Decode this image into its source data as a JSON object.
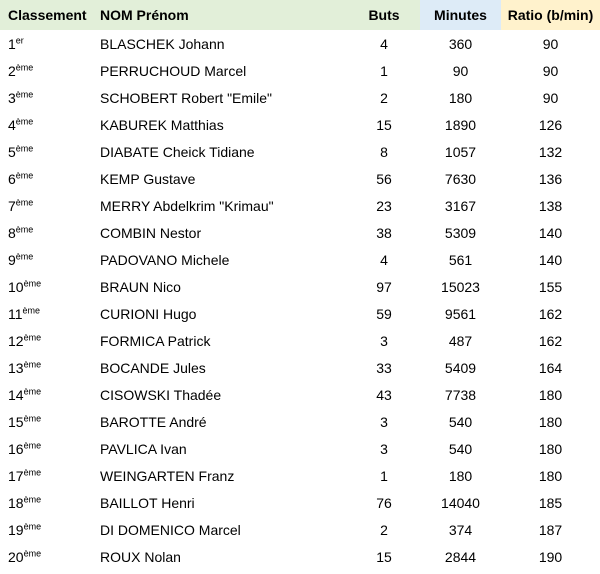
{
  "headers": {
    "rank": "Classement",
    "name": "NOM Prénom",
    "goals": "Buts",
    "minutes": "Minutes",
    "ratio": "Ratio (b/min)"
  },
  "colors": {
    "header_green": "#e2efd9",
    "header_blue": "#ddebf7",
    "header_yellow": "#fff2cc"
  },
  "rows": [
    {
      "rank": "1",
      "suffix": "er",
      "name": "BLASCHEK Johann",
      "goals": "4",
      "minutes": "360",
      "ratio": "90"
    },
    {
      "rank": "2",
      "suffix": "ème",
      "name": "PERRUCHOUD Marcel",
      "goals": "1",
      "minutes": "90",
      "ratio": "90"
    },
    {
      "rank": "3",
      "suffix": "ème",
      "name": "SCHOBERT Robert \"Emile\"",
      "goals": "2",
      "minutes": "180",
      "ratio": "90"
    },
    {
      "rank": "4",
      "suffix": "ème",
      "name": "KABUREK Matthias",
      "goals": "15",
      "minutes": "1890",
      "ratio": "126"
    },
    {
      "rank": "5",
      "suffix": "ème",
      "name": "DIABATE Cheick Tidiane",
      "goals": "8",
      "minutes": "1057",
      "ratio": "132"
    },
    {
      "rank": "6",
      "suffix": "ème",
      "name": "KEMP Gustave",
      "goals": "56",
      "minutes": "7630",
      "ratio": "136"
    },
    {
      "rank": "7",
      "suffix": "ème",
      "name": "MERRY Abdelkrim \"Krimau\"",
      "goals": "23",
      "minutes": "3167",
      "ratio": "138"
    },
    {
      "rank": "8",
      "suffix": "ème",
      "name": "COMBIN Nestor",
      "goals": "38",
      "minutes": "5309",
      "ratio": "140"
    },
    {
      "rank": "9",
      "suffix": "ème",
      "name": "PADOVANO Michele",
      "goals": "4",
      "minutes": "561",
      "ratio": "140"
    },
    {
      "rank": "10",
      "suffix": "ème",
      "name": "BRAUN Nico",
      "goals": "97",
      "minutes": "15023",
      "ratio": "155"
    },
    {
      "rank": "11",
      "suffix": "ème",
      "name": "CURIONI Hugo",
      "goals": "59",
      "minutes": "9561",
      "ratio": "162"
    },
    {
      "rank": "12",
      "suffix": "ème",
      "name": "FORMICA Patrick",
      "goals": "3",
      "minutes": "487",
      "ratio": "162"
    },
    {
      "rank": "13",
      "suffix": "ème",
      "name": "BOCANDE Jules",
      "goals": "33",
      "minutes": "5409",
      "ratio": "164"
    },
    {
      "rank": "14",
      "suffix": "ème",
      "name": "CISOWSKI Thadée",
      "goals": "43",
      "minutes": "7738",
      "ratio": "180"
    },
    {
      "rank": "15",
      "suffix": "ème",
      "name": "BAROTTE André",
      "goals": "3",
      "minutes": "540",
      "ratio": "180"
    },
    {
      "rank": "16",
      "suffix": "ème",
      "name": "PAVLICA Ivan",
      "goals": "3",
      "minutes": "540",
      "ratio": "180"
    },
    {
      "rank": "17",
      "suffix": "ème",
      "name": "WEINGARTEN Franz",
      "goals": "1",
      "minutes": "180",
      "ratio": "180"
    },
    {
      "rank": "18",
      "suffix": "ème",
      "name": "BAILLOT Henri",
      "goals": "76",
      "minutes": "14040",
      "ratio": "185"
    },
    {
      "rank": "19",
      "suffix": "ème",
      "name": "DI DOMENICO Marcel",
      "goals": "2",
      "minutes": "374",
      "ratio": "187"
    },
    {
      "rank": "20",
      "suffix": "ème",
      "name": "ROUX Nolan",
      "goals": "15",
      "minutes": "2844",
      "ratio": "190"
    }
  ]
}
